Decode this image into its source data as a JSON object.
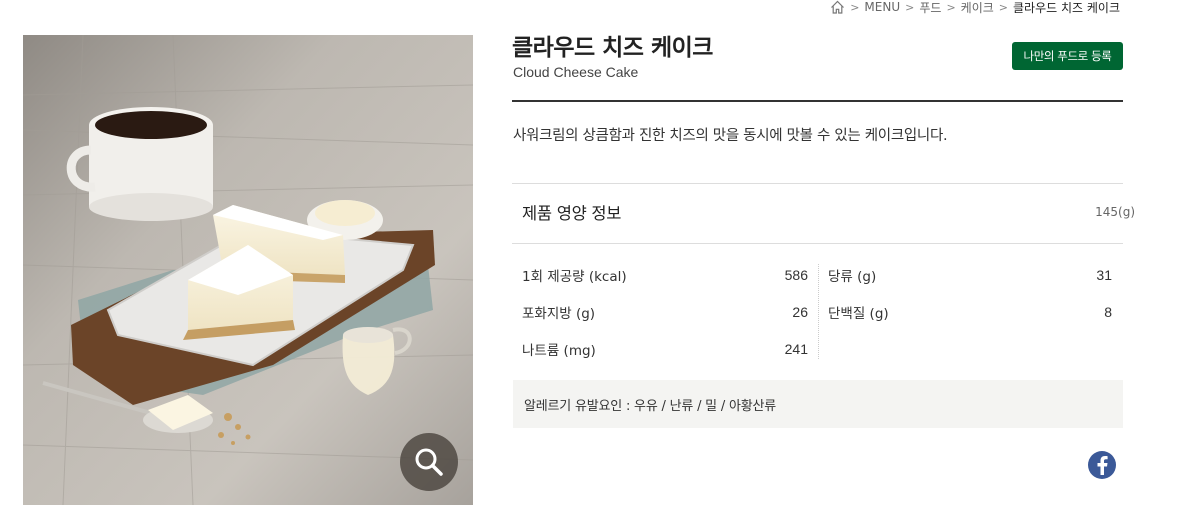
{
  "breadcrumb": {
    "home_icon": "home-icon",
    "items": [
      "MENU",
      "푸드",
      "케이크"
    ],
    "current": "클라우드 치즈 케이크"
  },
  "product": {
    "name_ko": "클라우드 치즈 케이크",
    "name_en": "Cloud Cheese Cake",
    "favorite_button": "나만의 푸드로 등록",
    "description": "사워크림의 상큼함과 진한 치즈의 맛을 동시에 맛볼 수 있는 케이크입니다."
  },
  "nutrition": {
    "title": "제품 영양 정보",
    "weight": "145(g)",
    "left": [
      {
        "label": "1회 제공량 (kcal)",
        "value": "586"
      },
      {
        "label": "포화지방 (g)",
        "value": "26"
      },
      {
        "label": "나트륨 (mg)",
        "value": "241"
      }
    ],
    "right": [
      {
        "label": "당류 (g)",
        "value": "31"
      },
      {
        "label": "단백질 (g)",
        "value": "8"
      }
    ]
  },
  "allergy": {
    "text": "알레르기 유발요인 : 우유 / 난류 / 밀 / 아황산류"
  },
  "icons": {
    "zoom": "magnifier-icon",
    "share": "facebook-icon"
  },
  "colors": {
    "brand_green": "#006633",
    "facebook_blue": "#3b5998"
  }
}
